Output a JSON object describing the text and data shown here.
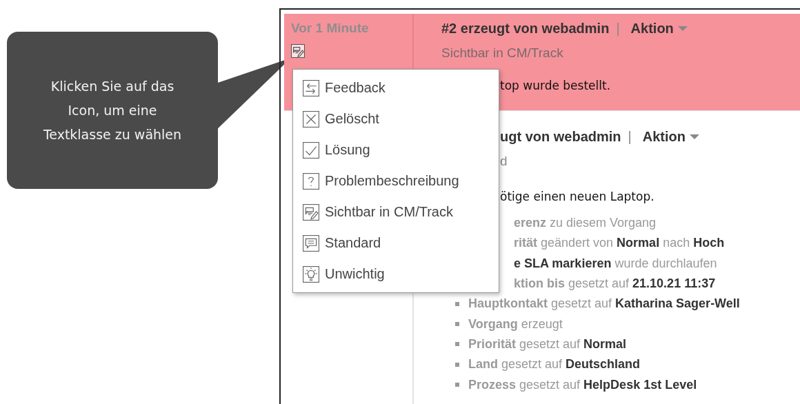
{
  "callout": {
    "text": "Klicken Sie auf das Icon, um eine Textklasse zu wählen"
  },
  "entries": [
    {
      "time": "Vor 1 Minute",
      "highlighted": true,
      "kind": "visible",
      "header": "#2 erzeugt von webadmin",
      "separator": "|",
      "action": "Aktion",
      "subtitle": "Sichtbar in CM/Track",
      "body": "top wurde bestellt."
    },
    {
      "highlighted": false,
      "header": "ugt von webadmin",
      "separator": "|",
      "action": "Aktion",
      "subtitle": "d",
      "body": "ötige einen neuen Laptop.",
      "history": [
        {
          "parts": [
            {
              "kind": "label",
              "t": "erenz"
            },
            {
              "kind": "text",
              "t": "zu diesem Vorgang"
            }
          ]
        },
        {
          "parts": [
            {
              "kind": "label",
              "t": "rität"
            },
            {
              "kind": "text",
              "t": "geändert von"
            },
            {
              "kind": "value",
              "t": "Normal"
            },
            {
              "kind": "text",
              "t": "nach"
            },
            {
              "kind": "value",
              "t": "Hoch"
            }
          ]
        },
        {
          "parts": [
            {
              "kind": "value",
              "t": "e SLA markieren"
            },
            {
              "kind": "text",
              "t": "wurde durchlaufen"
            }
          ]
        },
        {
          "parts": [
            {
              "kind": "label",
              "t": "ktion bis"
            },
            {
              "kind": "text",
              "t": "gesetzt auf"
            },
            {
              "kind": "value",
              "t": "21.10.21 11:37"
            }
          ]
        },
        {
          "parts": [
            {
              "kind": "label",
              "t": "Hauptkontakt"
            },
            {
              "kind": "text",
              "t": "gesetzt auf"
            },
            {
              "kind": "value",
              "t": "Katharina Sager-Well"
            }
          ]
        },
        {
          "parts": [
            {
              "kind": "label",
              "t": "Vorgang"
            },
            {
              "kind": "text",
              "t": "erzeugt"
            }
          ]
        },
        {
          "parts": [
            {
              "kind": "label",
              "t": "Priorität"
            },
            {
              "kind": "text",
              "t": "gesetzt auf"
            },
            {
              "kind": "value",
              "t": "Normal"
            }
          ]
        },
        {
          "parts": [
            {
              "kind": "label",
              "t": "Land"
            },
            {
              "kind": "text",
              "t": "gesetzt auf"
            },
            {
              "kind": "value",
              "t": "Deutschland"
            }
          ]
        },
        {
          "parts": [
            {
              "kind": "label",
              "t": "Prozess"
            },
            {
              "kind": "text",
              "t": "gesetzt auf"
            },
            {
              "kind": "value",
              "t": "HelpDesk 1st Level"
            }
          ]
        }
      ]
    }
  ],
  "menu": {
    "items": [
      {
        "kind": "feedback",
        "label": "Feedback"
      },
      {
        "kind": "deleted",
        "label": "Gelöscht"
      },
      {
        "kind": "solution",
        "label": "Lösung"
      },
      {
        "kind": "question",
        "label": "Problembeschreibung"
      },
      {
        "kind": "visible",
        "label": "Sichtbar in CM/Track"
      },
      {
        "kind": "standard",
        "label": "Standard"
      },
      {
        "kind": "unimportant",
        "label": "Unwichtig"
      }
    ]
  }
}
